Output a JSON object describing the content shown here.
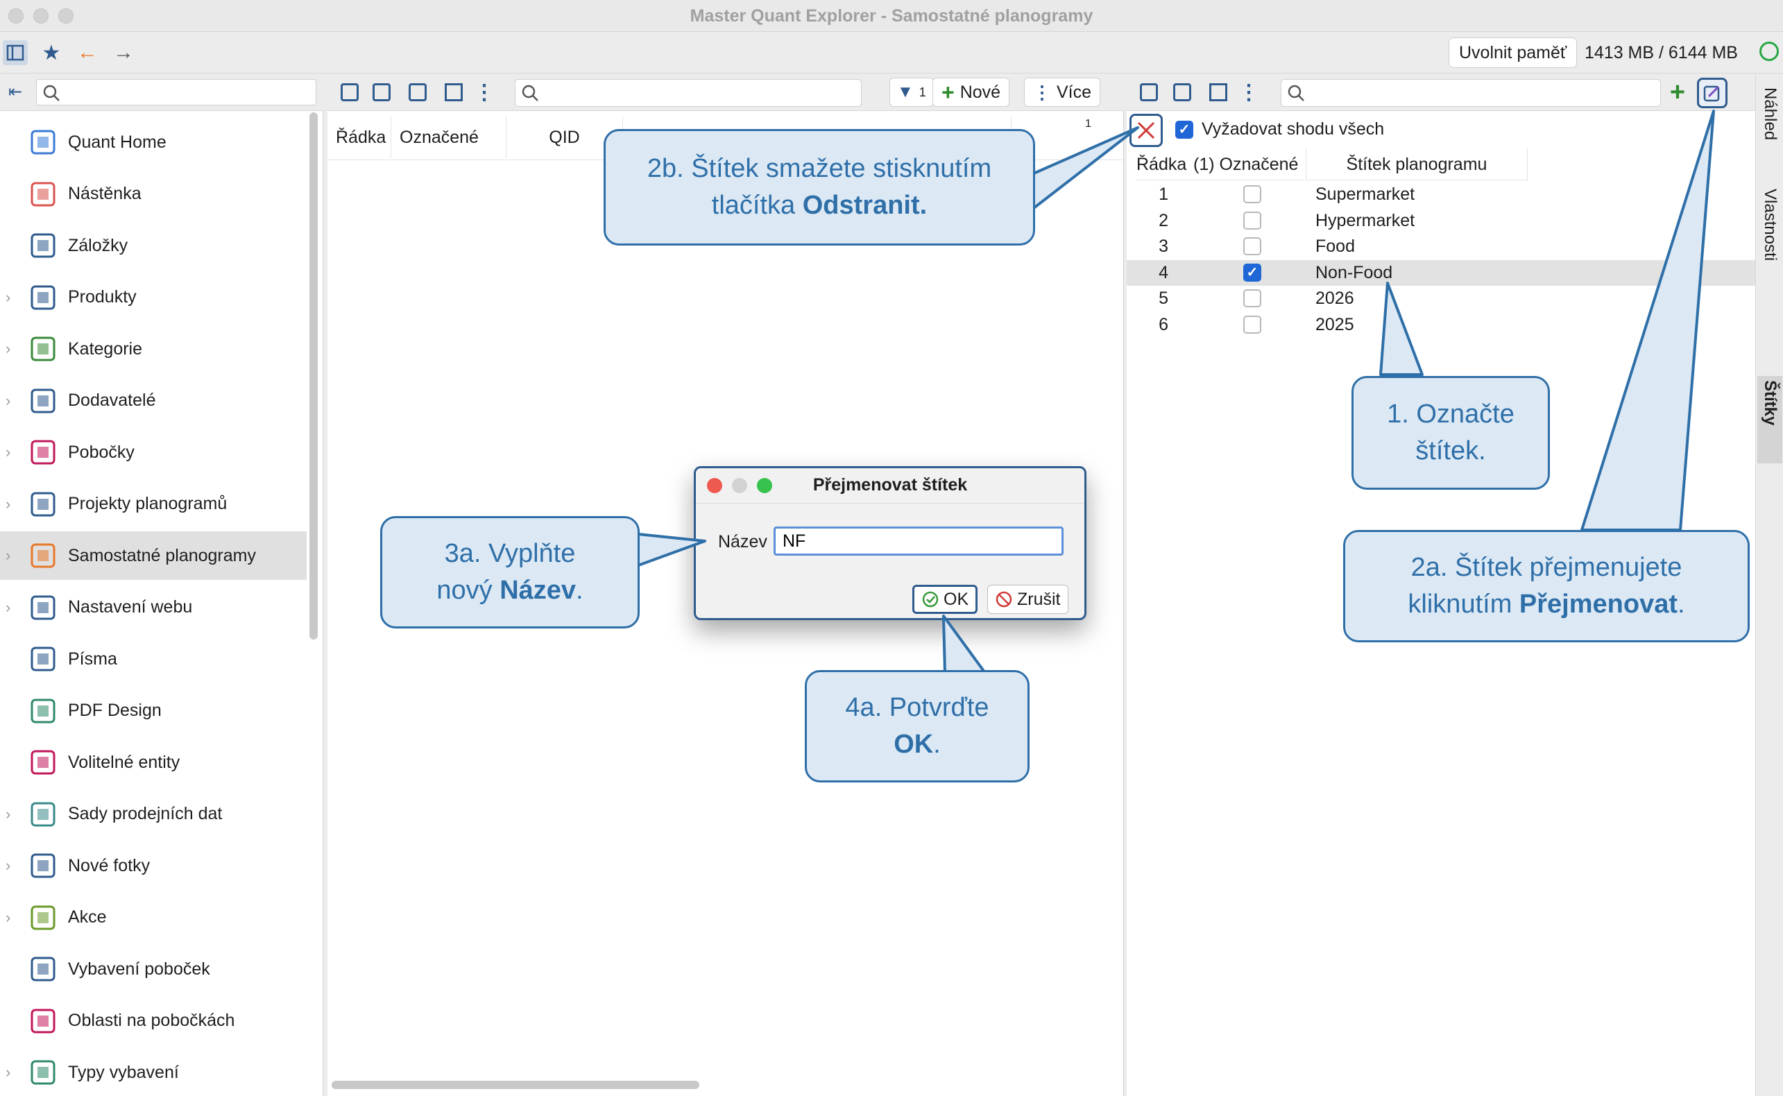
{
  "window": {
    "title": "Master Quant Explorer - Samostatné planogramy"
  },
  "toolbar": {
    "release_memory": "Uvolnit paměť",
    "memory": "1413 MB / 6144 MB"
  },
  "sidebar": {
    "items": [
      {
        "label": "Quant Home",
        "icon": "quant-home-icon",
        "chevron": false
      },
      {
        "label": "Nástěnka",
        "icon": "dashboard-icon",
        "chevron": false
      },
      {
        "label": "Záložky",
        "icon": "bookmark-icon",
        "chevron": false
      },
      {
        "label": "Produkty",
        "icon": "product-icon",
        "chevron": true
      },
      {
        "label": "Kategorie",
        "icon": "category-icon",
        "chevron": true
      },
      {
        "label": "Dodavatelé",
        "icon": "supplier-icon",
        "chevron": true
      },
      {
        "label": "Pobočky",
        "icon": "store-icon",
        "chevron": true
      },
      {
        "label": "Projekty planogramů",
        "icon": "planogram-project-icon",
        "chevron": true
      },
      {
        "label": "Samostatné planogramy",
        "icon": "planogram-icon",
        "chevron": true,
        "selected": true
      },
      {
        "label": "Nastavení webu",
        "icon": "web-settings-icon",
        "chevron": true
      },
      {
        "label": "Písma",
        "icon": "fonts-icon",
        "chevron": false
      },
      {
        "label": "PDF Design",
        "icon": "pdf-design-icon",
        "chevron": false
      },
      {
        "label": "Volitelné entity",
        "icon": "optional-entities-icon",
        "chevron": false
      },
      {
        "label": "Sady prodejních dat",
        "icon": "sales-data-icon",
        "chevron": true
      },
      {
        "label": "Nové fotky",
        "icon": "camera-icon",
        "chevron": true
      },
      {
        "label": "Akce",
        "icon": "promotion-icon",
        "chevron": true
      },
      {
        "label": "Vybavení poboček",
        "icon": "store-equipment-icon",
        "chevron": false
      },
      {
        "label": "Oblasti na pobočkách",
        "icon": "store-areas-icon",
        "chevron": false
      },
      {
        "label": "Typy vybavení",
        "icon": "equipment-types-icon",
        "chevron": true
      }
    ]
  },
  "middle": {
    "filter_count": "1",
    "new_label": "Nové",
    "more_label": "Více",
    "columns": [
      "Řádka",
      "Označené",
      "QID"
    ],
    "sort_badge": "1"
  },
  "right": {
    "require_all_label": "Vyžadovat shodu všech",
    "columns": {
      "row": "Řádka",
      "marked": "(1) Označené",
      "tag": "Štítek planogramu"
    },
    "rows": [
      {
        "num": "1",
        "label": "Supermarket",
        "checked": false
      },
      {
        "num": "2",
        "label": "Hypermarket",
        "checked": false
      },
      {
        "num": "3",
        "label": "Food",
        "checked": false
      },
      {
        "num": "4",
        "label": "Non-Food",
        "checked": true
      },
      {
        "num": "5",
        "label": "2026",
        "checked": false
      },
      {
        "num": "6",
        "label": "2025",
        "checked": false
      }
    ]
  },
  "side_tabs": [
    "Náhled",
    "Vlastnosti",
    "Štítky"
  ],
  "dialog": {
    "title": "Přejmenovat štítek",
    "name_label": "Název",
    "name_value": "NF",
    "ok_label": "OK",
    "cancel_label": "Zrušit"
  },
  "callouts": {
    "c2b_line1": "2b. Štítek smažete stisknutím",
    "c2b_line2a": "tlačítka ",
    "c2b_line2b": "Odstranit.",
    "c1_line1": "1. Označte",
    "c1_line2": "štítek.",
    "c3a_line1": "3a. Vyplňte",
    "c3a_line2a": "nový ",
    "c3a_line2b": "Název",
    "c3a_line2c": ".",
    "c2a_line1": "2a. Štítek přejmenujete",
    "c2a_line2a": "kliknutím ",
    "c2a_line2b": "Přejmenovat",
    "c2a_line2c": ".",
    "c4a_line1": "4a. Potvrďte",
    "c4a_line2a": "OK",
    "c4a_line2b": "."
  },
  "colors": {
    "accent": "#2f6fa8",
    "callout_bg": "#dce9f5",
    "checkbox": "#1f66d6",
    "delete": "#d23b3b"
  }
}
